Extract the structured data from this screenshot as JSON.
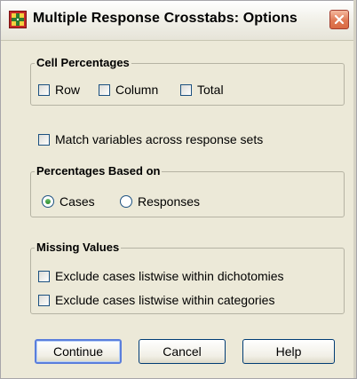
{
  "window": {
    "title": "Multiple Response Crosstabs: Options"
  },
  "cell_percentages": {
    "legend": "Cell Percentages",
    "row": {
      "label": "Row",
      "checked": false
    },
    "column": {
      "label": "Column",
      "checked": false
    },
    "total": {
      "label": "Total",
      "checked": false
    }
  },
  "match_variables": {
    "label": "Match variables across response sets",
    "checked": false
  },
  "percentages_based_on": {
    "legend": "Percentages Based on",
    "selected": "Cases",
    "cases": {
      "label": "Cases"
    },
    "responses": {
      "label": "Responses"
    }
  },
  "missing_values": {
    "legend": "Missing Values",
    "dichotomies": {
      "label": "Exclude cases listwise within dichotomies",
      "checked": false
    },
    "categories": {
      "label": "Exclude cases listwise within categories",
      "checked": false
    }
  },
  "buttons": {
    "continue": "Continue",
    "cancel": "Cancel",
    "help": "Help"
  },
  "colors": {
    "dialog_bg": "#ece9d8",
    "close_button": "#d96a43",
    "focus_border": "#5a7edc",
    "radio_dot": "#2b8a2b"
  },
  "icons": {
    "app": "crosstabs-app-icon",
    "close": "close-icon"
  }
}
